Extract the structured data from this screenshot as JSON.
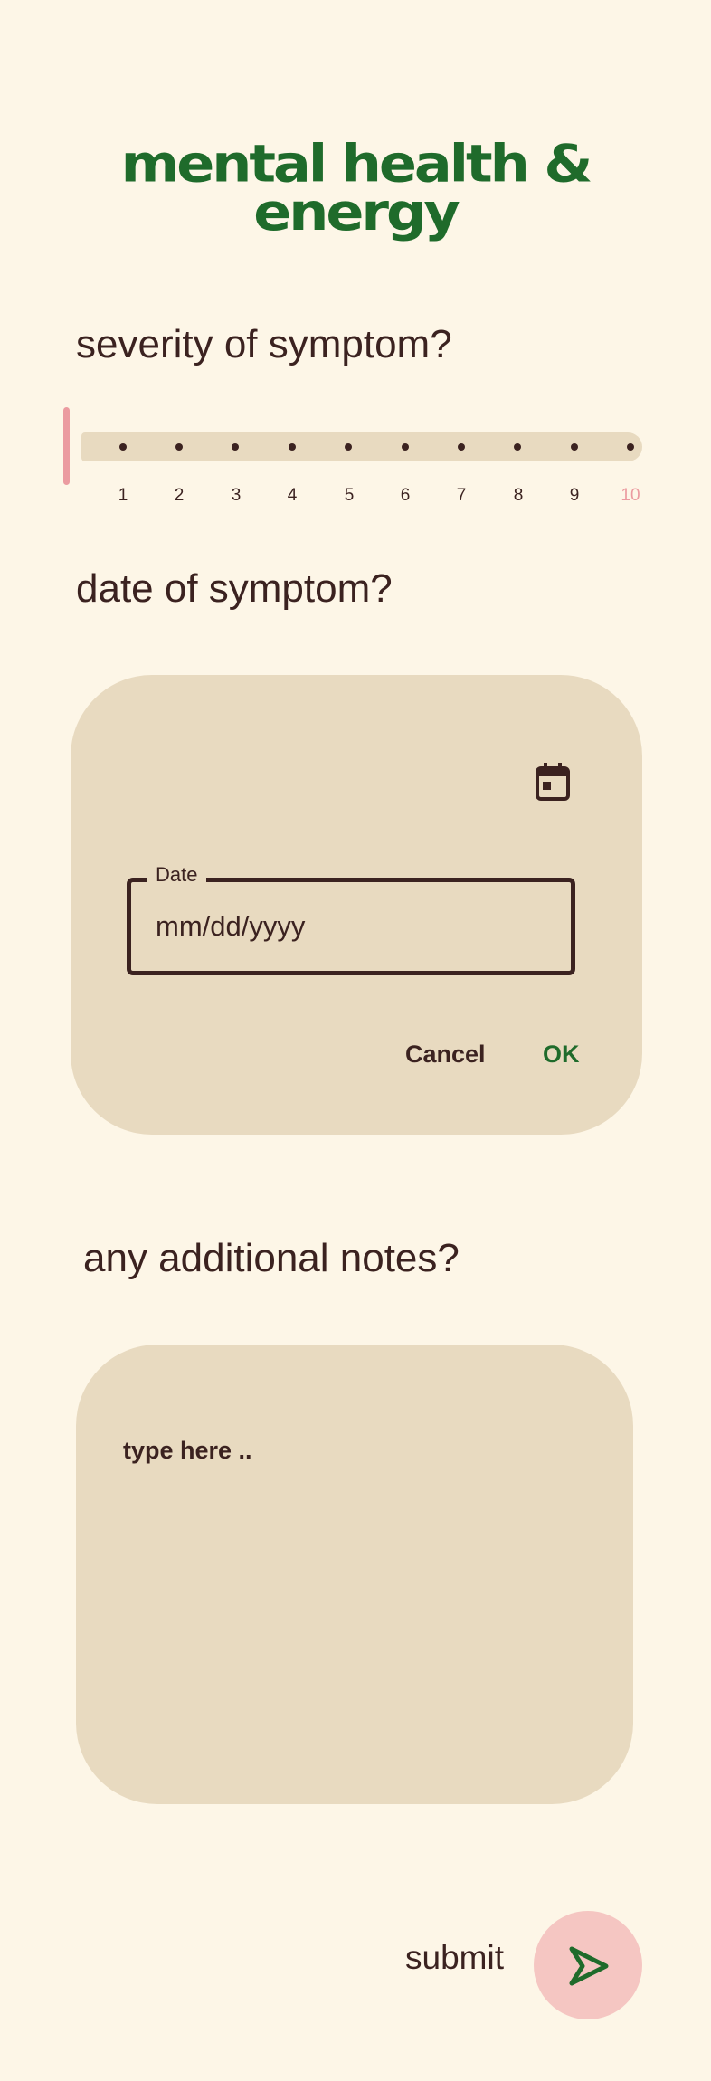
{
  "header": {
    "title_line1": "mental health &",
    "title_line2": "energy"
  },
  "severity": {
    "question": "severity of symptom?",
    "ticks": [
      "1",
      "2",
      "3",
      "4",
      "5",
      "6",
      "7",
      "8",
      "9",
      "10"
    ],
    "selected_value": 10,
    "accent_color": "#eb9ba0"
  },
  "date": {
    "question": "date of symptom?",
    "field_label": "Date",
    "field_placeholder": "mm/dd/yyyy",
    "cancel_label": "Cancel",
    "ok_label": "OK",
    "icon": "calendar-icon"
  },
  "notes": {
    "question": "any additional notes?",
    "placeholder": "type here .."
  },
  "submit": {
    "label": "submit",
    "icon": "send-arrow-icon"
  },
  "colors": {
    "background": "#fdf6e7",
    "card": "#e8dac0",
    "brand_green": "#1f6b2b",
    "text": "#3b2220",
    "pink": "#f5c6c2"
  }
}
